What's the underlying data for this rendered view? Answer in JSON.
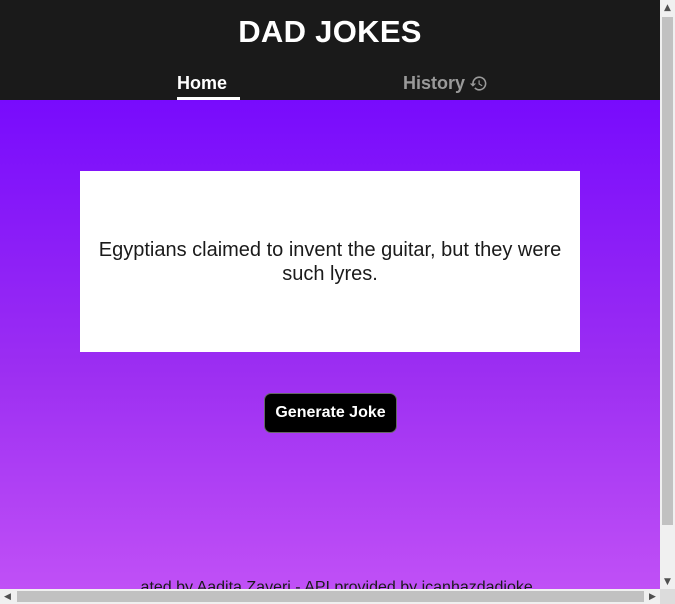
{
  "header": {
    "title": "DAD JOKES",
    "tabs": [
      {
        "label": "Home",
        "active": true
      },
      {
        "label": "History",
        "icon": "history-icon",
        "active": false
      }
    ]
  },
  "main": {
    "joke": "Egyptians claimed to invent the guitar, but they were such lyres.",
    "generate_label": "Generate Joke",
    "footer": "...ated by Aadita Zaveri - API provided by icanhazdadjoke"
  },
  "colors": {
    "header_bg": "#1a1a1a",
    "gradient_top": "#780bfd",
    "gradient_bottom": "#c050f6",
    "button_bg": "#000000"
  },
  "scrollbars": {
    "up_arrow": "▲",
    "down_arrow": "▼",
    "left_arrow": "◀",
    "right_arrow": "▶"
  }
}
